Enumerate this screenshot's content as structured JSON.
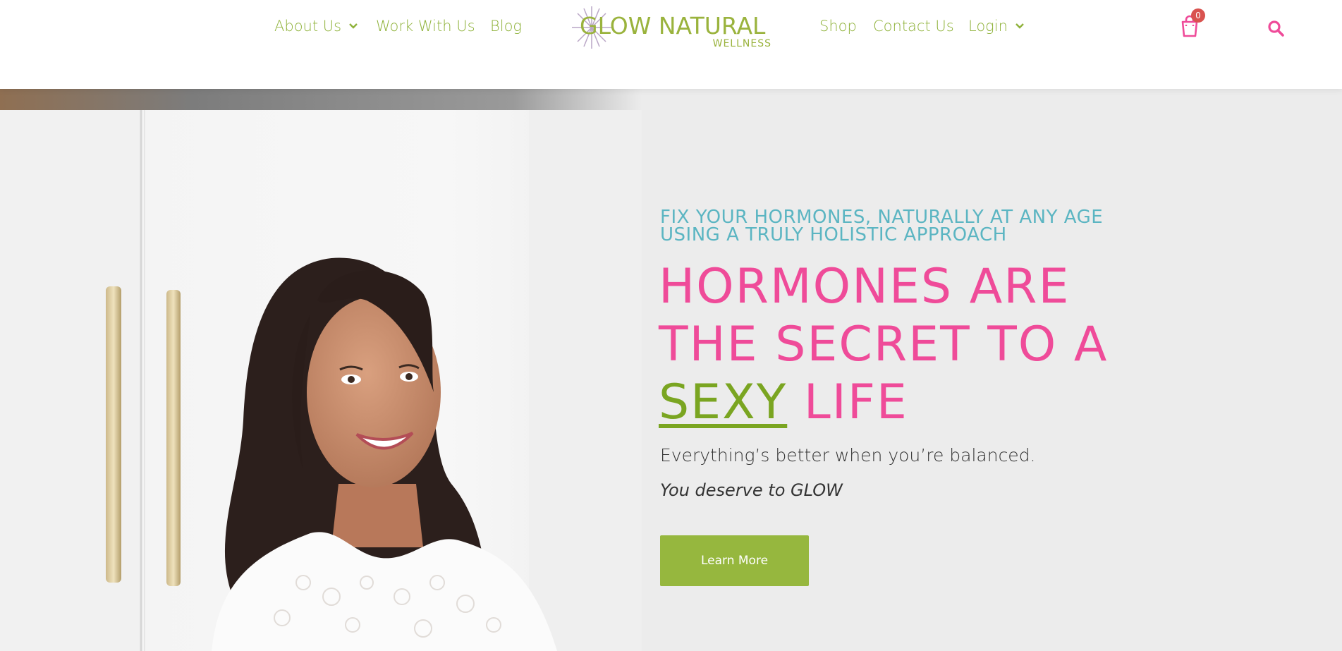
{
  "nav": {
    "left": [
      {
        "label": "About Us",
        "has_dropdown": true
      },
      {
        "label": "Work With Us",
        "has_dropdown": false
      },
      {
        "label": "Blog",
        "has_dropdown": false
      }
    ],
    "right": [
      {
        "label": "Shop",
        "has_dropdown": false
      },
      {
        "label": "Contact Us",
        "has_dropdown": false
      },
      {
        "label": "Login",
        "has_dropdown": true
      }
    ],
    "logo": {
      "line1": "GLOW NATURAL",
      "line2": "WELLNESS"
    },
    "cart_count": "0",
    "icons": {
      "cart": "shopping-bag-icon",
      "search": "search-icon",
      "dropdown": "chevron-down-icon"
    }
  },
  "hero": {
    "eyebrow": "FIX YOUR HORMONES, NATURALLY AT ANY AGE USING A TRULY HOLISTIC APPROACH",
    "headline_part1": "HORMONES ARE THE SECRET TO A",
    "headline_accent": "SEXY",
    "headline_part2": "LIFE",
    "tagline": "Everything’s better when you’re balanced.",
    "tagline2": "You deserve to GLOW",
    "cta_label": "Learn More"
  },
  "colors": {
    "nav_green": "#8fb23a",
    "brand_pink": "#ef4b99",
    "brand_teal": "#5bb5c2",
    "accent_green": "#7aa521",
    "cta_green": "#96b73e",
    "hero_bg": "#ececec"
  }
}
